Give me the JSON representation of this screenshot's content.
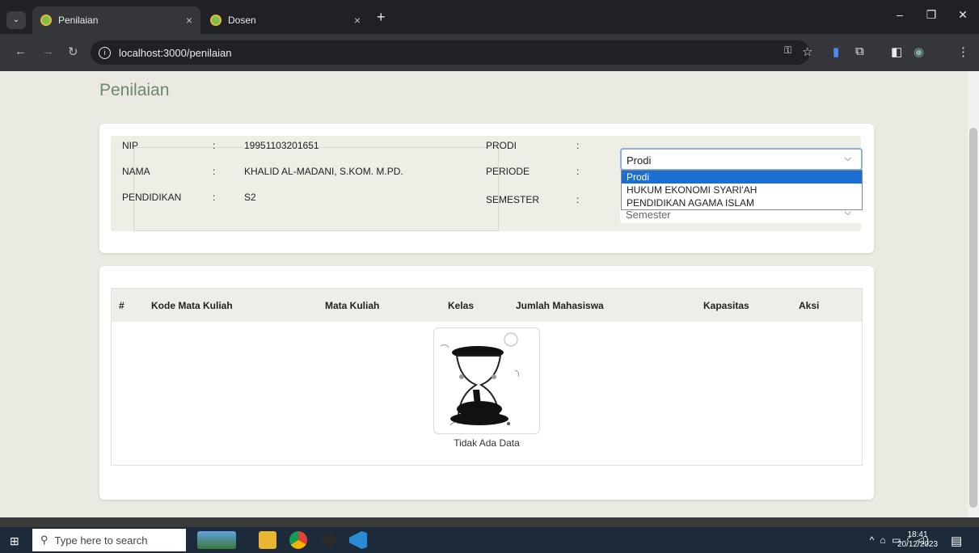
{
  "browser": {
    "tabs": [
      {
        "title": "Penilaian",
        "close": "×"
      },
      {
        "title": "Dosen",
        "close": "×"
      }
    ],
    "new_tab": "+",
    "url": "localhost:3000/penilaian",
    "window_controls": {
      "minimize": "–",
      "restore": "❐",
      "close": "✕"
    }
  },
  "page": {
    "title": "Penilaian",
    "info": {
      "rows": [
        {
          "label": "NIP",
          "sep": ":",
          "value": "19951103201651"
        },
        {
          "label": "NAMA",
          "sep": ":",
          "value": "KHALID AL-MADANI, S.KOM. M.PD."
        },
        {
          "label": "PENDIDIKAN",
          "sep": ":",
          "value": "S2"
        }
      ],
      "filters": [
        {
          "label": "PRODI",
          "sep": ":"
        },
        {
          "label": "PERIODE",
          "sep": ":"
        },
        {
          "label": "SEMESTER",
          "sep": ":"
        }
      ],
      "prodi_select": {
        "value": "Prodi",
        "options": [
          "Prodi",
          "HUKUM EKONOMI SYARI'AH",
          "PENDIDIKAN AGAMA ISLAM"
        ]
      },
      "semester_select": {
        "value": "Semester"
      }
    },
    "table": {
      "columns": [
        "#",
        "Kode Mata Kuliah",
        "Mata Kuliah",
        "Kelas",
        "Jumlah Mahasiswa",
        "Kapasitas",
        "Aksi"
      ],
      "empty_text": "Tidak Ada Data"
    }
  },
  "taskbar": {
    "search_placeholder": "Type here to search",
    "time": "18:41",
    "date": "20/12/2023"
  },
  "colors": {
    "title_green": "#6a8a6a",
    "selected_option": "#1b6fd1",
    "page_bg": "#eaeae2"
  }
}
